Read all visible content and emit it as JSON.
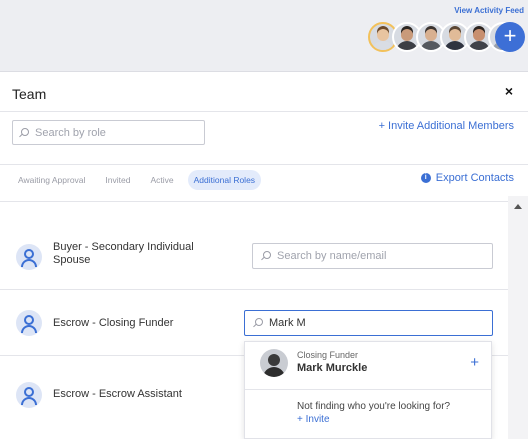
{
  "header": {
    "activity_feed_link": "View Activity Feed",
    "add_button_label": "+",
    "avatars": [
      {
        "name": "avatar-1",
        "skin": "#e8c4a0",
        "hair": "#6b4a2b",
        "shirt": "#d9dde4"
      },
      {
        "name": "avatar-2",
        "skin": "#c99a7a",
        "hair": "#2a2522",
        "shirt": "#3c3e45"
      },
      {
        "name": "avatar-3",
        "skin": "#d8b090",
        "hair": "#3a3330",
        "shirt": "#55595f"
      },
      {
        "name": "avatar-4",
        "skin": "#e1bb98",
        "hair": "#5a4634",
        "shirt": "#2f3440"
      },
      {
        "name": "avatar-5",
        "skin": "#c89070",
        "hair": "#2b2420",
        "shirt": "#40434a"
      },
      {
        "name": "avatar-6",
        "skin": "#eac8aa",
        "hair": "#8a6a4a",
        "shirt": "#9aa0ab"
      }
    ]
  },
  "panel": {
    "title": "Team",
    "close_label": "×",
    "role_search_placeholder": "Search by role",
    "invite_members_link": "+ Invite Additional Members",
    "tabs": [
      {
        "label": "Awaiting Approval",
        "active": false
      },
      {
        "label": "Invited",
        "active": false
      },
      {
        "label": "Active",
        "active": false
      },
      {
        "label": "Additional Roles",
        "active": true
      }
    ],
    "export_label": "Export Contacts",
    "export_icon": "i"
  },
  "roles": [
    {
      "label": "Buyer - Secondary Individual Spouse",
      "search_placeholder": "Search by name/email",
      "search_value": ""
    },
    {
      "label": "Escrow - Closing Funder",
      "search_placeholder": "",
      "search_value": "Mark M"
    },
    {
      "label": "Escrow - Escrow Assistant",
      "search_placeholder": "",
      "search_value": ""
    }
  ],
  "dropdown": {
    "result_role": "Closing Funder",
    "result_name": "Mark Murckle",
    "add_label": "+",
    "not_finding_text": "Not finding who you're looking for?",
    "invite_link": "+ Invite"
  },
  "colors": {
    "accent": "#3b6fd4",
    "background": "#edeef2"
  }
}
